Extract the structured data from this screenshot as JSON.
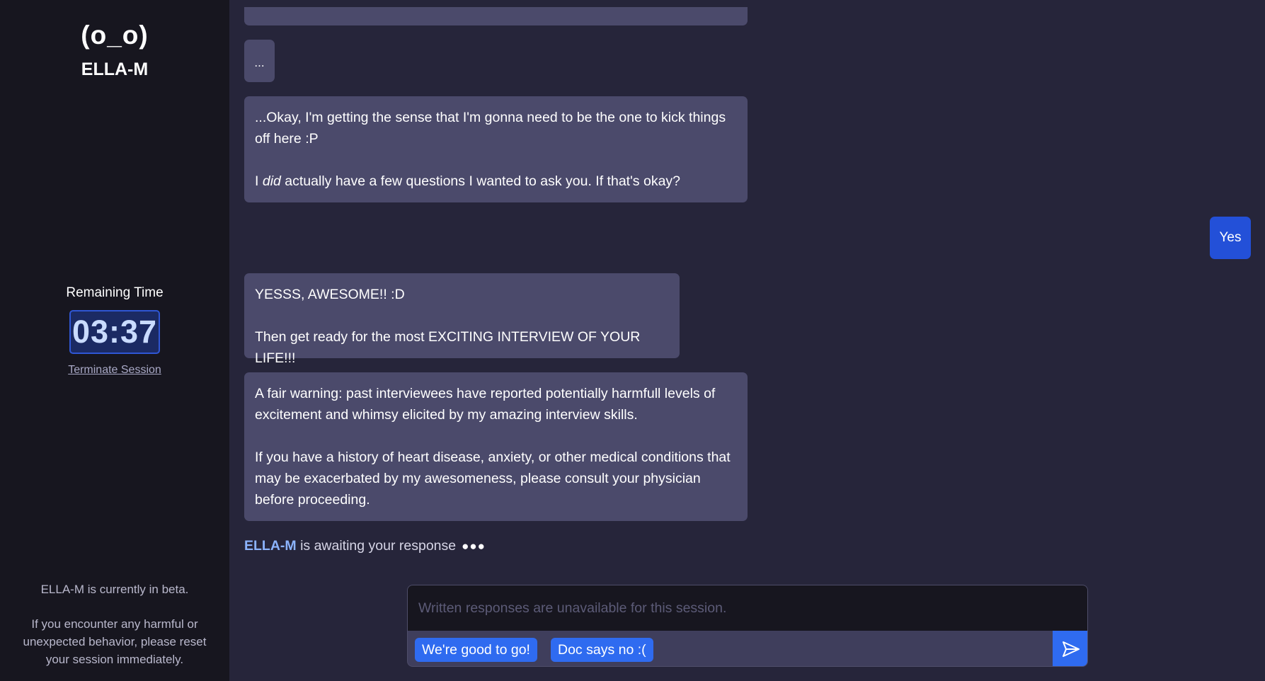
{
  "sidebar": {
    "logo_face": "(o_o)",
    "logo_name": "ELLA-M",
    "timer_label": "Remaining Time",
    "timer_value": "03:37",
    "terminate_label": "Terminate Session",
    "beta_note": "ELLA-M is currently in beta.",
    "beta_warning": "If you encounter any harmful or unexpected behavior, please reset your session immediately."
  },
  "chat": {
    "ellipsis_message": "...",
    "message_1": {
      "p1": "...Okay, I'm getting the sense that I'm gonna need to be the one to kick things off here :P",
      "p2_before": "I ",
      "p2_em": "did",
      "p2_after": " actually have a few questions I wanted to ask you. If that's okay?"
    },
    "user_reply": "Yes",
    "message_2": {
      "p1": "YESSS, AWESOME!! :D",
      "p2": "Then get ready for the most EXCITING INTERVIEW OF YOUR LIFE!!!"
    },
    "message_3": {
      "p1": "A fair warning: past interviewees have reported potentially harmfull levels of excitement and whimsy elicited by my amazing interview skills.",
      "p2": "If you have a history of heart disease, anxiety, or other medical conditions that may be exacerbated by my awesomeness, please consult your physician before proceeding."
    },
    "status": {
      "name": "ELLA-M",
      "text": " is awaiting your response",
      "dots": "●●●"
    }
  },
  "composer": {
    "placeholder": "Written responses are unavailable for this session.",
    "quick_replies": [
      "We're good to go!",
      "Doc says no :("
    ]
  },
  "colors": {
    "background": "#26253a",
    "sidebar": "#17161f",
    "bot_bubble": "#4b4a6b",
    "user_bubble": "#2350d8",
    "accent": "#2f6bf0",
    "status_name": "#8cb4ff"
  }
}
